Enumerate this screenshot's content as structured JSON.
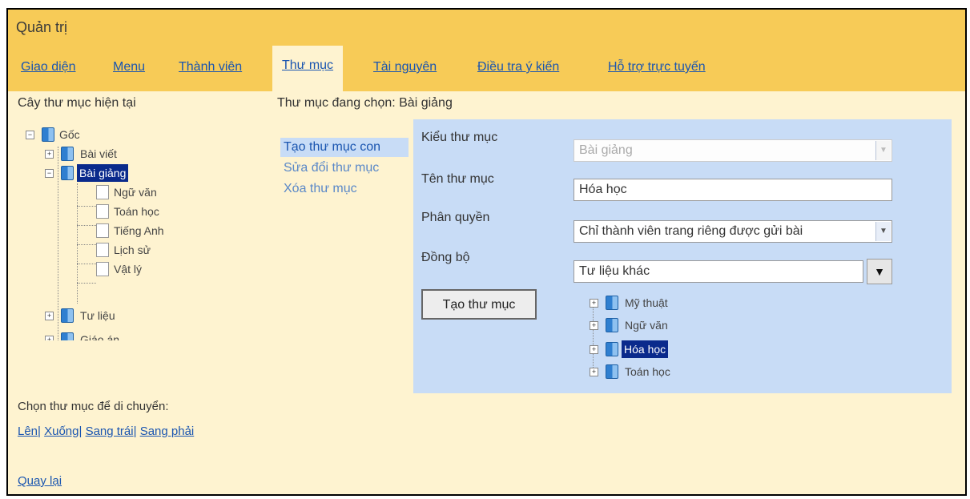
{
  "header": {
    "title": "Quản trị"
  },
  "tabs": [
    {
      "label": "Giao diện"
    },
    {
      "label": "Menu"
    },
    {
      "label": "Thành viên"
    },
    {
      "label": "Thư mục"
    },
    {
      "label": "Tài nguyên"
    },
    {
      "label": "Điều tra ý kiến"
    },
    {
      "label": "Hỗ trợ trực tuyến"
    }
  ],
  "left": {
    "title": "Cây thư mục hiện tại",
    "tree": {
      "root": "Gốc",
      "folders": [
        "Bài viết",
        "Bài giảng"
      ],
      "children": [
        "Ngữ văn",
        "Toán học",
        "Tiếng Anh",
        "Lịch sử",
        "Vật lý"
      ],
      "after": [
        "Tư liệu",
        "Giáo án"
      ]
    },
    "move_label": "Chọn thư mục để di chuyển:",
    "move_links": [
      "Lên",
      "Xuống",
      "Sang trái",
      "Sang phải"
    ],
    "back": "Quay lại"
  },
  "right": {
    "current_label": "Thư mục đang chọn: Bài giảng",
    "actions": [
      "Tạo thư mục con",
      "Sửa đổi thư mục",
      "Xóa thư mục"
    ],
    "form": {
      "type_label": "Kiểu thư mục",
      "type_value": "Bài giảng",
      "name_label": "Tên thư mục",
      "name_value": "Hóa học",
      "perm_label": "Phân quyền",
      "perm_value": "Chỉ thành viên trang riêng được gửi bài",
      "sync_label": "Đồng bộ",
      "sync_value": "Tư liệu khác",
      "submit": "Tạo thư mục",
      "sync_tree": [
        "Mỹ thuật",
        "Ngữ văn",
        "Hóa học",
        "Toán học"
      ]
    }
  },
  "colors": {
    "header": "#f7cb57",
    "body": "#fef3d0",
    "form": "#c8dcf6",
    "link": "#1a55b0",
    "selection": "#0a2a8c"
  }
}
